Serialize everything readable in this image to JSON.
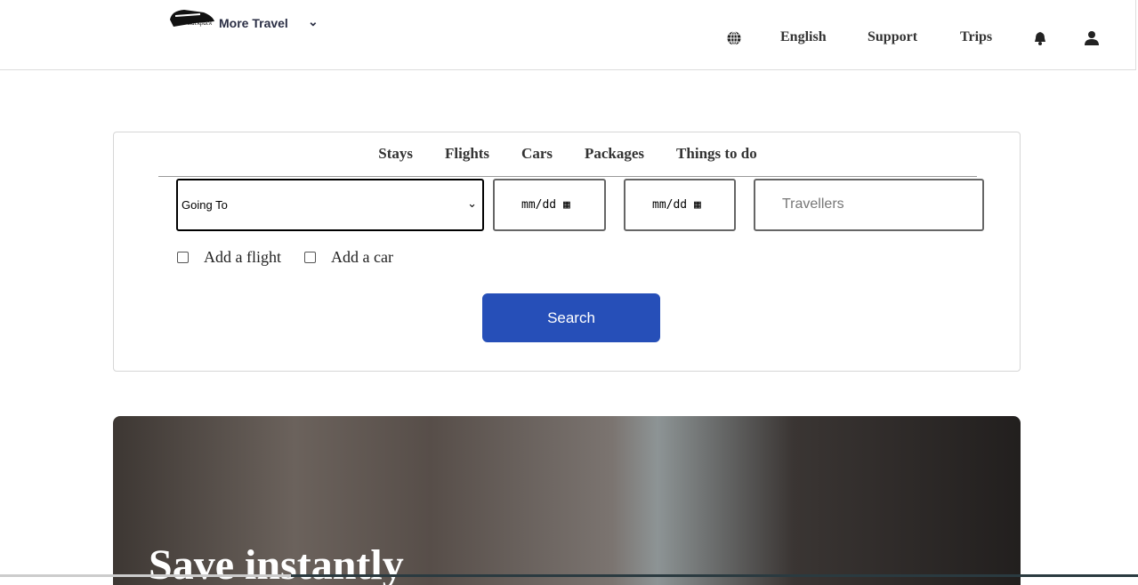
{
  "header": {
    "brand": "More Travel",
    "nav": [
      "English",
      "Support",
      "Trips"
    ]
  },
  "search": {
    "tabs": [
      "Stays",
      "Flights",
      "Cars",
      "Packages",
      "Things to do"
    ],
    "going_to": "Going To",
    "date_placeholder": "mm/dd",
    "travellers_placeholder": "Travellers",
    "options": [
      "Add a flight",
      "Add a car"
    ],
    "button": "Search",
    "accent": "#264fb8"
  },
  "hero": {
    "title": "Save instantly"
  }
}
